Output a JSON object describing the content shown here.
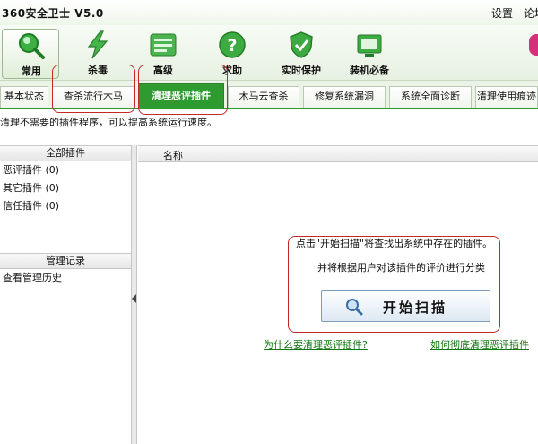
{
  "app": {
    "title": "360安全卫士 V5.0",
    "settings": "设置",
    "forum": "论坛"
  },
  "toolbar": {
    "items": [
      {
        "label": "常用",
        "icon": "magnifier-icon"
      },
      {
        "label": "杀毒",
        "icon": "lightning-icon"
      },
      {
        "label": "高级",
        "icon": "list-icon"
      },
      {
        "label": "求助",
        "icon": "question-icon"
      },
      {
        "label": "实时保护",
        "icon": "shield-icon"
      },
      {
        "label": "装机必备",
        "icon": "install-icon"
      }
    ]
  },
  "tabs": [
    {
      "label": "基本状态"
    },
    {
      "label": "查杀流行木马"
    },
    {
      "label": "清理恶评插件"
    },
    {
      "label": "木马云查杀"
    },
    {
      "label": "修复系统漏洞"
    },
    {
      "label": "系统全面诊断"
    },
    {
      "label": "清理使用痕迹"
    }
  ],
  "subtitle": "清理不需要的插件程序，可以提高系统运行速度。",
  "left": {
    "plugins_header": "全部插件",
    "plugins": [
      {
        "label": "恶评插件 (0)"
      },
      {
        "label": "其它插件 (0)"
      },
      {
        "label": "信任插件 (0)"
      }
    ],
    "records_header": "管理记录",
    "records": [
      {
        "label": "查看管理历史"
      }
    ]
  },
  "main": {
    "column_name": "名称",
    "message_line1": "点击\"开始扫描\"将查找出系统中存在的插件。",
    "message_line2": "并将根据用户对该插件的评价进行分类",
    "scan_button": "开始扫描",
    "link_why": "为什么要清理恶评插件?",
    "link_how": "如何彻底清理恶评插件"
  },
  "colors": {
    "accent": "#2f9a2f",
    "annotation": "#c62828",
    "link": "#117711"
  }
}
